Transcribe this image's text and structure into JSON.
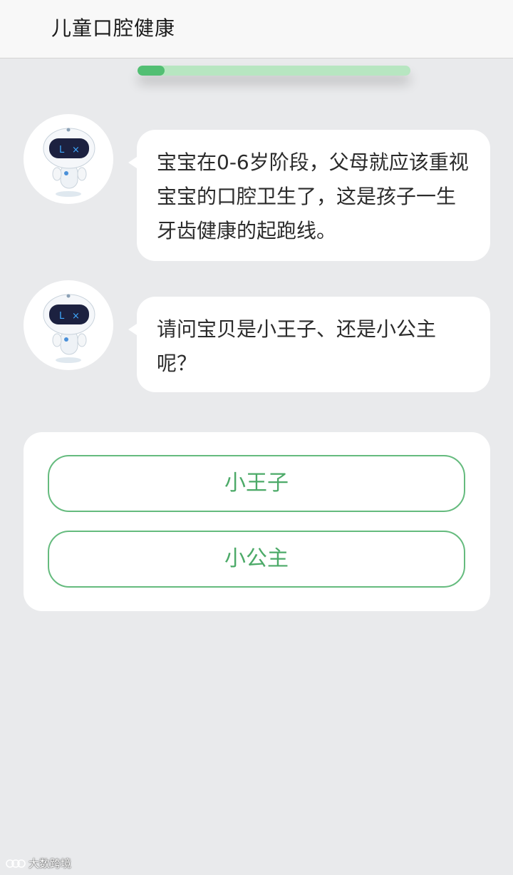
{
  "header": {
    "title": "儿童口腔健康"
  },
  "progress": {
    "value_fraction": 0.1
  },
  "messages": [
    {
      "avatar": "robot-mascot-icon",
      "text": "宝宝在0-6岁阶段，父母就应该重视宝宝的口腔卫生了，这是孩子一生牙齿健康的起跑线。"
    },
    {
      "avatar": "robot-mascot-icon",
      "text": "请问宝贝是小王子、还是小公主呢？"
    }
  ],
  "options": [
    {
      "label": "小王子"
    },
    {
      "label": "小公主"
    }
  ],
  "watermark": {
    "text": "大数跨境"
  },
  "colors": {
    "background": "#e9eaec",
    "accent_green": "#52bf73",
    "progress_track": "#b7e6c1",
    "option_border": "#65bb7e",
    "option_text": "#4caa68"
  }
}
